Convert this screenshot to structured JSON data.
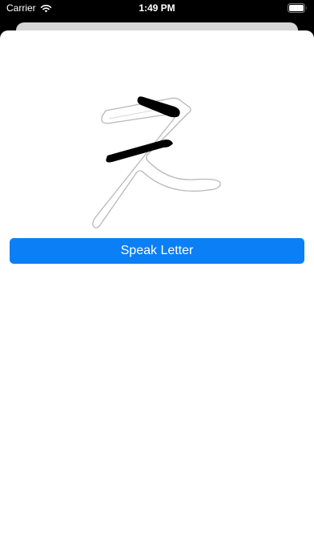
{
  "status_bar": {
    "carrier": "Carrier",
    "time": "1:49 PM",
    "wifi_icon": "wifi-icon",
    "battery_icon": "battery-icon"
  },
  "letter": {
    "glyph": "え",
    "image_description_icon": "letter-stroke-image"
  },
  "actions": {
    "speak_label": "Speak Letter"
  },
  "colors": {
    "accent": "#0b7ff6",
    "background": "#000000",
    "sheet": "#ffffff",
    "sheet_back": "#d6d6d6"
  }
}
